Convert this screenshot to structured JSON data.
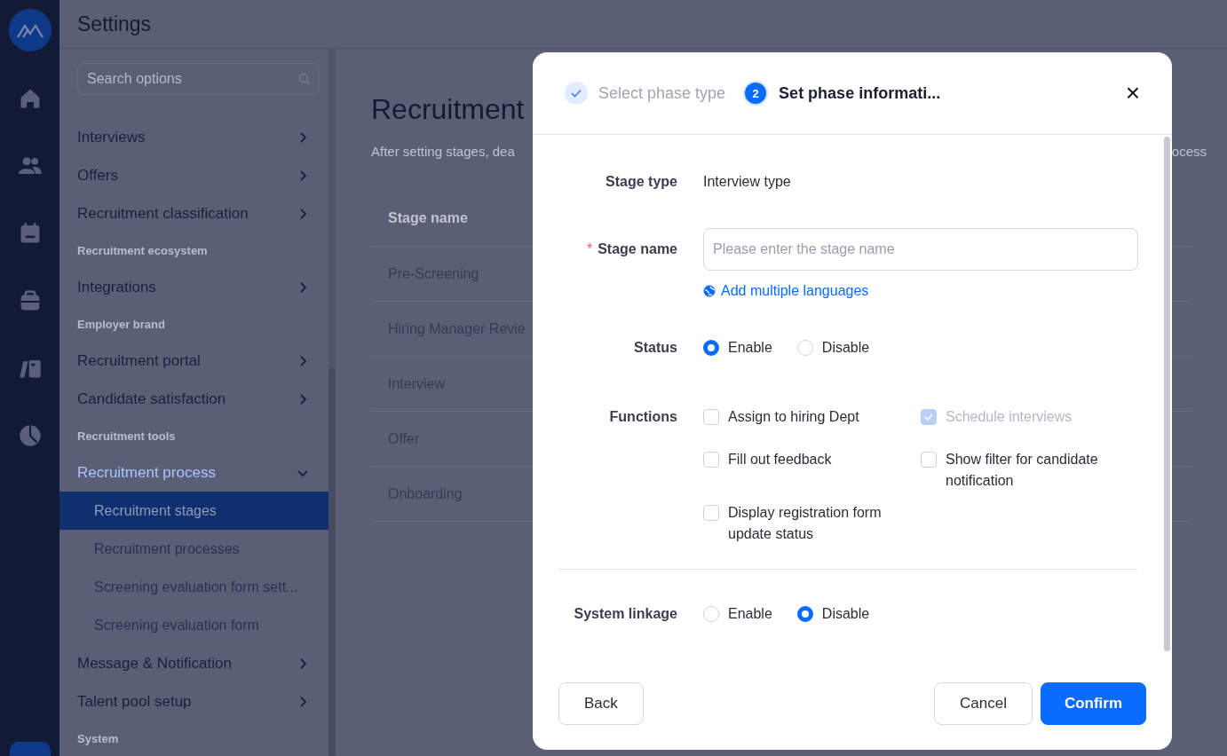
{
  "header": {
    "title": "Settings"
  },
  "settings_menu": {
    "search": {
      "placeholder": "Search options"
    },
    "items": [
      {
        "kind": "item",
        "label": "Interviews",
        "expanded": false
      },
      {
        "kind": "item",
        "label": "Offers",
        "expanded": false
      },
      {
        "kind": "item",
        "label": "Recruitment classification",
        "expanded": false
      },
      {
        "kind": "group",
        "label": "Recruitment ecosystem"
      },
      {
        "kind": "item",
        "label": "Integrations",
        "expanded": false
      },
      {
        "kind": "group",
        "label": "Employer brand"
      },
      {
        "kind": "item",
        "label": "Recruitment portal",
        "expanded": false
      },
      {
        "kind": "item",
        "label": "Candidate satisfaction",
        "expanded": false
      },
      {
        "kind": "group",
        "label": "Recruitment tools"
      },
      {
        "kind": "item",
        "label": "Recruitment process",
        "expanded": true
      },
      {
        "kind": "subitem",
        "label": "Recruitment stages",
        "selected": true
      },
      {
        "kind": "subitem",
        "label": "Recruitment processes",
        "selected": false
      },
      {
        "kind": "subitem",
        "label": "Screening evaluation form sett...",
        "selected": false
      },
      {
        "kind": "subitem",
        "label": "Screening evaluation form",
        "selected": false
      },
      {
        "kind": "item",
        "label": "Message & Notification",
        "expanded": false
      },
      {
        "kind": "item",
        "label": "Talent pool setup",
        "expanded": false
      },
      {
        "kind": "group",
        "label": "System"
      }
    ]
  },
  "page": {
    "title": "Recruitment",
    "description": "After setting stages, dea",
    "description_end": "ocess",
    "table": {
      "columns": [
        "Stage name"
      ],
      "rows": [
        "Pre-Screening",
        "Hiring Manager Revie",
        "Interview",
        "Offer",
        "Onboarding"
      ]
    }
  },
  "dialog": {
    "steps": [
      {
        "label": "Select phase type",
        "completed": true
      },
      {
        "label": "Set phase informati...",
        "number": "2",
        "completed": false
      }
    ],
    "close": "×",
    "stage_type": {
      "label": "Stage type",
      "value": "Interview type"
    },
    "stage_name": {
      "label": "Stage name",
      "required": true,
      "required_mark": "*",
      "placeholder": "Please enter the stage name"
    },
    "languages_link": "Add multiple languages",
    "status": {
      "label": "Status",
      "options": [
        {
          "label": "Enable",
          "selected": true
        },
        {
          "label": "Disable",
          "selected": false
        }
      ]
    },
    "functions": {
      "label": "Functions",
      "options": [
        {
          "label": "Assign to hiring Dept",
          "checked": false,
          "disabled": false
        },
        {
          "label": "Schedule interviews",
          "checked": true,
          "disabled": true
        },
        {
          "label": "Fill out feedback",
          "checked": false,
          "disabled": false
        },
        {
          "label": "Show filter for candidate notification",
          "checked": false,
          "disabled": false
        },
        {
          "label": "Display registration form update status",
          "checked": false,
          "disabled": false
        }
      ]
    },
    "system_linkage": {
      "label": "System linkage",
      "options": [
        {
          "label": "Enable",
          "selected": false
        },
        {
          "label": "Disable",
          "selected": true
        }
      ]
    },
    "buttons": {
      "back": "Back",
      "cancel": "Cancel",
      "confirm": "Confirm"
    }
  }
}
